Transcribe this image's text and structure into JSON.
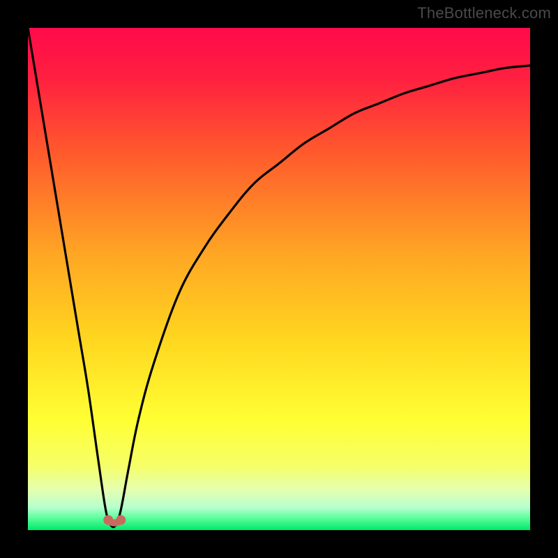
{
  "watermark": "TheBottleneck.com",
  "chart_data": {
    "type": "line",
    "title": "",
    "xlabel": "",
    "ylabel": "",
    "xlim": [
      0,
      100
    ],
    "ylim": [
      0,
      100
    ],
    "series": [
      {
        "name": "bottleneck-curve",
        "x": [
          0,
          2,
          4,
          6,
          8,
          10,
          12,
          14,
          15.5,
          16.5,
          17.5,
          18.5,
          20,
          22,
          25,
          30,
          35,
          40,
          45,
          50,
          55,
          60,
          65,
          70,
          75,
          80,
          85,
          90,
          95,
          100
        ],
        "y": [
          100,
          88,
          76,
          64,
          52,
          40,
          28,
          14,
          4,
          1,
          1,
          4,
          12,
          22,
          33,
          47,
          56,
          63,
          69,
          73,
          77,
          80,
          83,
          85,
          87,
          88.5,
          90,
          91,
          92,
          92.5
        ]
      }
    ],
    "markers": [
      {
        "name": "min-left",
        "x": 16.0,
        "y": 2.0
      },
      {
        "name": "min-right",
        "x": 18.5,
        "y": 2.0
      }
    ],
    "gradient_stops": [
      {
        "pos": 0.0,
        "color": "#ff0a4a"
      },
      {
        "pos": 0.1,
        "color": "#ff2040"
      },
      {
        "pos": 0.25,
        "color": "#ff5a2c"
      },
      {
        "pos": 0.45,
        "color": "#ffa624"
      },
      {
        "pos": 0.62,
        "color": "#ffd61f"
      },
      {
        "pos": 0.78,
        "color": "#ffff33"
      },
      {
        "pos": 0.87,
        "color": "#f6ff66"
      },
      {
        "pos": 0.92,
        "color": "#e4ffb0"
      },
      {
        "pos": 0.955,
        "color": "#b6ffcf"
      },
      {
        "pos": 0.975,
        "color": "#5eff9d"
      },
      {
        "pos": 1.0,
        "color": "#00e86b"
      }
    ]
  }
}
